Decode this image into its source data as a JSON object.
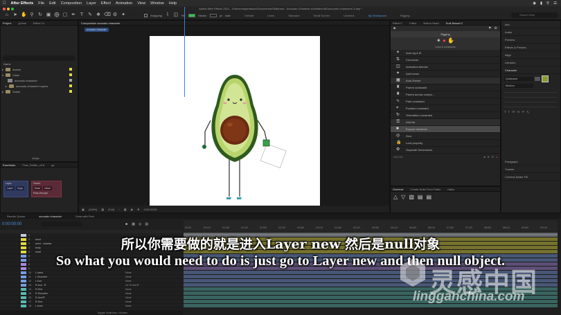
{
  "menubar": {
    "app": "After Effects",
    "items": [
      "File",
      "Edit",
      "Composition",
      "Layer",
      "Effect",
      "Animation",
      "View",
      "Window",
      "Help"
    ]
  },
  "titlebar": {
    "text": "Adobe After Effects 2021 - /Users/meganfrasch/Documents/Skillshare - Avocado Character Animation/AE/avocado characters 3.aep *"
  },
  "toolbar": {
    "snapping": "Snapping",
    "fill_label": "Fill:",
    "stroke_label": "Stroke:",
    "stroke_value": "px",
    "add_label": "Add:",
    "workspaces": [
      "Default",
      "Learn",
      "Standard",
      "Small Screen",
      "Libraries",
      "My Workspace",
      "Rigging"
    ],
    "active_workspace": "My Workspace",
    "search_placeholder": "Search Help"
  },
  "project": {
    "tabs": [
      "Project",
      "gOlow",
      "Effect Co"
    ],
    "name_header": "Name",
    "items": [
      {
        "name": "Assets",
        "type": "folder",
        "indent": 0
      },
      {
        "name": "Class",
        "type": "folder",
        "indent": 0
      },
      {
        "name": "avocado character",
        "type": "comp",
        "indent": 1
      },
      {
        "name": "avocado character Layers",
        "type": "folder",
        "indent": 1
      },
      {
        "name": "Solids",
        "type": "folder",
        "indent": 0
      }
    ],
    "bit_depth": "16 bpc"
  },
  "essential": {
    "tabs": [
      "Essentials",
      "Flow_Shifter_v2.8",
      "gv"
    ],
    "left_head": "Layer",
    "left_btns": [
      "Layer",
      "Copy"
    ],
    "right_head": "Parent",
    "right_btns": [
      "Ease",
      "Value"
    ],
    "right_check": "Pass-through"
  },
  "comp": {
    "tab": "Composition avocado character",
    "subtab": "avocado character",
    "zoom": "(116%)",
    "quality": "(Full)",
    "timecode": "0:00:00:00"
  },
  "duik": {
    "tabs": [
      "Effect C",
      "Paths",
      "Button Head",
      "Duik Bassel.2"
    ],
    "section": "Rigging",
    "subsection": "Links & constraints",
    "items": [
      "Auto-rig & IK",
      "Connector",
      "Animation blender",
      "Add bones",
      "Auto-Parent",
      "Parent constraint",
      "Parent across comps...",
      "Path constraint",
      "Position constraint",
      "Orientation constraint",
      "Add list",
      "Expose transform",
      "Zero",
      "Lock property",
      "Separate Dimensions"
    ],
    "highlighted": "Expose transform",
    "version": "v16.2.24"
  },
  "compose": {
    "tabs": [
      "Overlord",
      "Create Nulls From Paths",
      "Haiku"
    ]
  },
  "info": {
    "items": [
      "Info",
      "Audio",
      "Preview",
      "Effects & Presets",
      "Align",
      "Libraries",
      "Character"
    ],
    "font": "Quicksand",
    "weight": "Medium",
    "bottom": [
      "Paragraph",
      "Tracker",
      "Content-Aware Fill"
    ],
    "accent": "#8a9a2e"
  },
  "timeline": {
    "tabs": [
      "Render Queue",
      "avocado character",
      "Draw with Feet"
    ],
    "timecode": "0:00:00:00",
    "ruler": [
      "00:00",
      "00:12f",
      "01:00f",
      "01:12f",
      "02:00f",
      "02:12f",
      "03:00f",
      "03:12f",
      "04:00f",
      "04:12f",
      "05:00f",
      "05:12f",
      "06:00f",
      "06:12f",
      "07:00f",
      "07:12f",
      "08:00f",
      "08:12f",
      "09:00f",
      "09:12f"
    ],
    "layers": [
      {
        "n": "1",
        "name": "",
        "color": "#c5ccd8",
        "parent": ""
      },
      {
        "n": "2",
        "name": "seed",
        "color": "#e0d840",
        "parent": ""
      },
      {
        "n": "3",
        "name": "seed - shadow",
        "color": "#e0d840",
        "parent": ""
      },
      {
        "n": "4",
        "name": "body",
        "color": "#e0d840",
        "parent": ""
      },
      {
        "n": "5",
        "name": "head",
        "color": "#e0d840",
        "parent": ""
      },
      {
        "n": "6",
        "name": "",
        "color": "#7a9ce0",
        "parent": ""
      },
      {
        "n": "7",
        "name": "",
        "color": "#7a9ce0",
        "parent": ""
      },
      {
        "n": "8",
        "name": "",
        "color": "#a98be0",
        "parent": ""
      },
      {
        "n": "9",
        "name": "",
        "color": "#a98be0",
        "parent": ""
      },
      {
        "n": "10",
        "name": "L.hand",
        "color": "#7a9ce0",
        "parent": "None"
      },
      {
        "n": "11",
        "name": "L.Shoulder",
        "color": "#7a9ce0",
        "parent": "None"
      },
      {
        "n": "12",
        "name": "L.foot",
        "color": "#7a9ce0",
        "parent": "None"
      },
      {
        "n": "13",
        "name": "R.foot - R",
        "color": "#7a9ce0",
        "parent": "14. R.hnd R"
      },
      {
        "n": "14",
        "name": "R.Hnd",
        "color": "#5ab9b0",
        "parent": "None"
      },
      {
        "n": "15",
        "name": "R.Shoulder",
        "color": "#5ab9b0",
        "parent": "None"
      },
      {
        "n": "16",
        "name": "R.Arm/R",
        "color": "#5ab9b0",
        "parent": "None"
      },
      {
        "n": "17",
        "name": "R.Hnd",
        "color": "#5ab9b0",
        "parent": "None"
      },
      {
        "n": "18",
        "name": "L.knee",
        "color": "#5ab9b0",
        "parent": "None"
      }
    ],
    "footer": "Toggle Switches / Modes"
  },
  "subtitle": {
    "cn": "所以你需要做的就是进入Layer new 然后是null对象",
    "en": "So what you would need to do is just go to Layer new and then null object."
  },
  "watermark": {
    "text": "灵感中国",
    "url": "lingganchina.com"
  },
  "colors": {
    "avocado_skin": "#2f5a1e",
    "avocado_flesh": "#b8d46c",
    "avocado_light": "#d9ea9c",
    "pit": "#6b2a12",
    "timeline_blue": "#3a7fe0"
  }
}
